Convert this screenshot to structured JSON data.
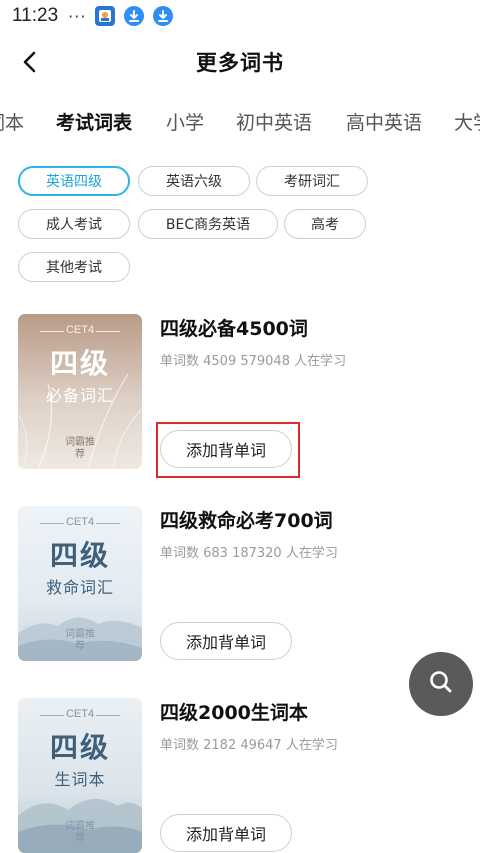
{
  "status_bar": {
    "time": "11:23",
    "dots": "···"
  },
  "header": {
    "title": "更多词书"
  },
  "tabs": [
    {
      "label": "词本"
    },
    {
      "label": "考试词表"
    },
    {
      "label": "小学"
    },
    {
      "label": "初中英语"
    },
    {
      "label": "高中英语"
    },
    {
      "label": "大学"
    }
  ],
  "chips": [
    {
      "label": "英语四级",
      "selected": true
    },
    {
      "label": "英语六级"
    },
    {
      "label": "考研词汇"
    },
    {
      "label": "成人考试"
    },
    {
      "label": "BEC商务英语"
    },
    {
      "label": "高考"
    },
    {
      "label": "其他考试"
    }
  ],
  "books": [
    {
      "title": "四级必备4500词",
      "meta": "单词数 4509  579048 人在学习",
      "cover": {
        "tag": "CET4",
        "main": "四级",
        "sub": "必备词汇",
        "brand": "词霸推荐"
      },
      "button": "添加背单词"
    },
    {
      "title": "四级救命必考700词",
      "meta": "单词数 683  187320 人在学习",
      "cover": {
        "tag": "CET4",
        "main": "四级",
        "sub": "救命词汇",
        "brand": "词霸推荐"
      },
      "button": "添加背单词"
    },
    {
      "title": "四级2000生词本",
      "meta": "单词数 2182  49647 人在学习",
      "cover": {
        "tag": "CET4",
        "main": "四级",
        "sub": "生词本",
        "brand": "词霸推荐"
      },
      "button": "添加背单词"
    }
  ],
  "icons": {
    "back": "chevron-left-icon",
    "search": "search-icon",
    "status_app": "gallery-app-icon",
    "status_download": "download-icon"
  },
  "colors": {
    "accent": "#29b6e6",
    "highlight": "#e02828",
    "fab": "#5a5a5a"
  }
}
